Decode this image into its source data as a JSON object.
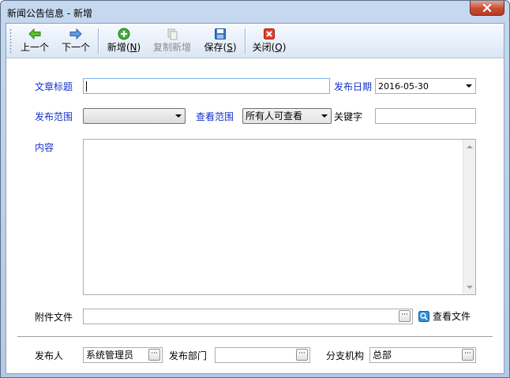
{
  "window": {
    "title": "新闻公告信息 - 新增"
  },
  "toolbar": {
    "prev_label": "上一个",
    "next_label": "下一个",
    "new_label": "新增",
    "new_key": "N",
    "copy_label": "复制新增",
    "save_label": "保存",
    "save_key": "S",
    "close_label": "关闭",
    "close_key": "Q"
  },
  "form": {
    "title_label": "文章标题",
    "title_value": "",
    "publish_date_label": "发布日期",
    "publish_date_value": "2016-05-30",
    "publish_scope_label": "发布范围",
    "publish_scope_value": "",
    "view_scope_label": "查看范围",
    "view_scope_value": "所有人可查看",
    "keyword_label": "关键字",
    "keyword_value": "",
    "content_label": "内容",
    "attachment_label": "附件文件",
    "attachment_value": "",
    "view_file_label": "查看文件",
    "publisher_label": "发布人",
    "publisher_value": "系统管理员",
    "dept_label": "发布部门",
    "dept_value": "",
    "branch_label": "分支机构",
    "branch_value": "总部"
  },
  "colors": {
    "accent_label": "#1630c8",
    "close_button": "#c74b35"
  }
}
